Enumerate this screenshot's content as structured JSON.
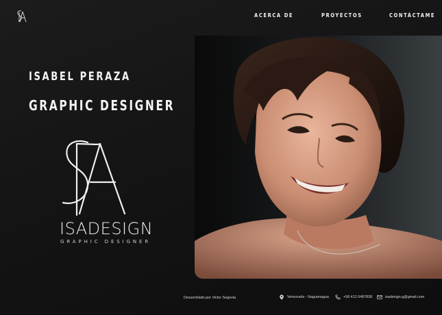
{
  "header": {
    "logo_alt": "SA",
    "nav": {
      "about": "ACERCA DE",
      "projects": "PROYECTOS",
      "contact": "CONTÁCTAME"
    }
  },
  "hero": {
    "name": "ISABEL PERAZA",
    "role": "GRAPHIC DESIGNER"
  },
  "brand": {
    "name": "ISADESIGN",
    "subtitle": "GRAPHIC DESIGNER"
  },
  "footer": {
    "credit": "Desarrollado por Victor Segovia",
    "location": "Venezuela - Naguanagua",
    "phone": "+58 412 0487838",
    "email": "isadesign.g@gmail.com"
  },
  "colors": {
    "background": "#111111",
    "text": "#f4f4f4"
  },
  "icons": {
    "location": "map-pin-icon",
    "phone": "phone-icon",
    "email": "envelope-icon"
  }
}
